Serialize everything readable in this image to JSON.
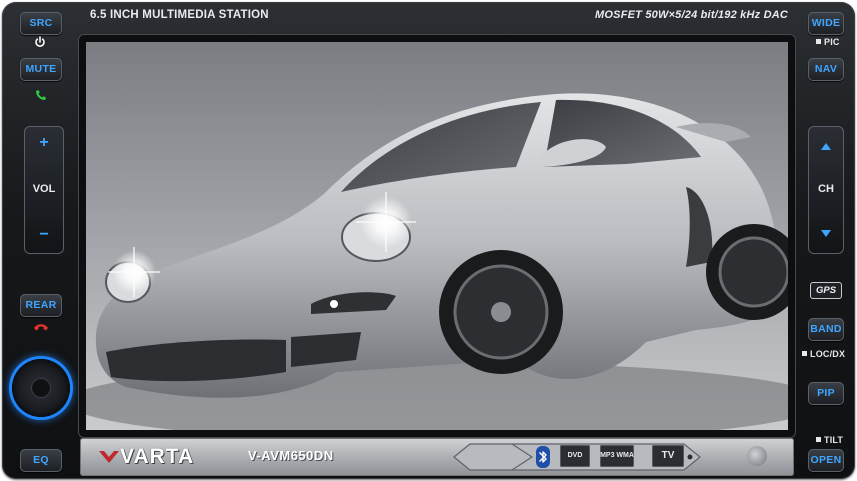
{
  "header": {
    "title": "6.5 INCH MULTIMEDIA STATION",
    "spec": "MOSFET 50W×5/24 bit/192 kHz DAC"
  },
  "left_panel": {
    "src_label": "SRC",
    "mute_label": "MUTE",
    "vol_label": "VOL",
    "vol_up": "+",
    "vol_down": "−",
    "rear_label": "REAR",
    "eq_label": "EQ"
  },
  "right_panel": {
    "wide_label": "WIDE",
    "pic_label": "PIC",
    "nav_label": "NAV",
    "ch_label": "CH",
    "gps_label": "GPS",
    "band_label": "BAND",
    "locdx_label": "LOC/DX",
    "pip_label": "PIP",
    "tilt_label": "TILT",
    "open_label": "OPEN"
  },
  "bottom": {
    "brand": "VARTA",
    "model": "V-AVM650DN",
    "badges": [
      "DVD",
      "MP3 WMA",
      "TV"
    ]
  },
  "colors": {
    "button_text": "#3ea6ff",
    "knob_glow": "#1d86ff",
    "brand_red": "#c1272d",
    "power_icon": "#ffffff",
    "call_icon": "#2ecc40",
    "hangup_icon": "#e0332b"
  },
  "icons": [
    "power-icon",
    "phone-call-icon",
    "phone-hangup-icon",
    "bluetooth-icon",
    "chevron-up-icon",
    "chevron-down-icon"
  ]
}
